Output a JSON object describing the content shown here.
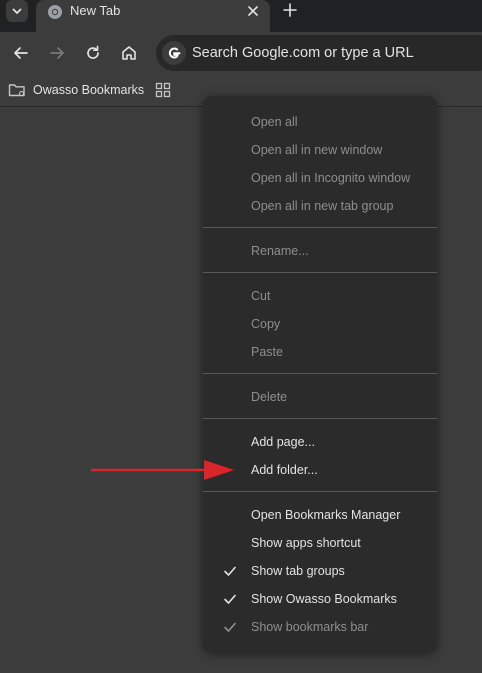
{
  "tabstrip": {
    "active_tab_title": "New Tab"
  },
  "toolbar": {
    "omnibox_placeholder": "Search Google.com or type a URL"
  },
  "bookmarks_bar": {
    "folder_label": "Owasso Bookmarks"
  },
  "menu": {
    "items": [
      {
        "label": "Open all",
        "enabled": false,
        "checked": false
      },
      {
        "label": "Open all in new window",
        "enabled": false,
        "checked": false
      },
      {
        "label": "Open all in Incognito window",
        "enabled": false,
        "checked": false
      },
      {
        "label": "Open all in new tab group",
        "enabled": false,
        "checked": false
      },
      {
        "label": "Rename...",
        "enabled": false,
        "checked": false
      },
      {
        "label": "Cut",
        "enabled": false,
        "checked": false
      },
      {
        "label": "Copy",
        "enabled": false,
        "checked": false
      },
      {
        "label": "Paste",
        "enabled": false,
        "checked": false
      },
      {
        "label": "Delete",
        "enabled": false,
        "checked": false
      },
      {
        "label": "Add page...",
        "enabled": true,
        "checked": false
      },
      {
        "label": "Add folder...",
        "enabled": true,
        "checked": false
      },
      {
        "label": "Open Bookmarks Manager",
        "enabled": true,
        "checked": false
      },
      {
        "label": "Show apps shortcut",
        "enabled": true,
        "checked": false
      },
      {
        "label": "Show tab groups",
        "enabled": true,
        "checked": true
      },
      {
        "label": "Show Owasso Bookmarks",
        "enabled": true,
        "checked": true
      },
      {
        "label": "Show bookmarks bar",
        "enabled": false,
        "checked": true
      }
    ]
  },
  "colors": {
    "annotation_arrow": "#d8262a",
    "menu_background": "#2b2b2b",
    "toolbar_background": "#3c3c3c",
    "tabstrip_background": "#202124"
  }
}
